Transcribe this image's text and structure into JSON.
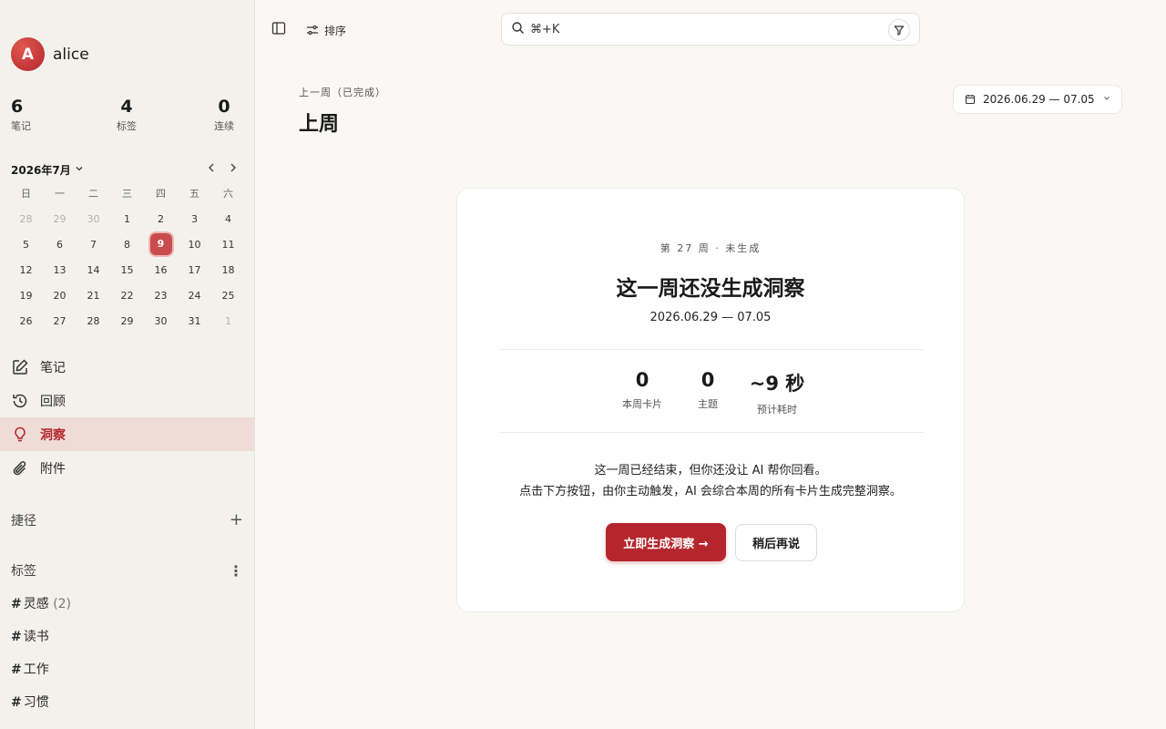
{
  "user": {
    "initial": "A",
    "name": "alice"
  },
  "stats": [
    {
      "value": "6",
      "label": "笔记"
    },
    {
      "value": "4",
      "label": "标签"
    },
    {
      "value": "0",
      "label": "连续"
    }
  ],
  "calendar": {
    "month_label": "2026年7月",
    "weekdays": [
      "日",
      "一",
      "二",
      "三",
      "四",
      "五",
      "六"
    ],
    "weeks": [
      [
        "28",
        "29",
        "30",
        "1",
        "2",
        "3",
        "4"
      ],
      [
        "5",
        "6",
        "7",
        "8",
        "9",
        "10",
        "11"
      ],
      [
        "12",
        "13",
        "14",
        "15",
        "16",
        "17",
        "18"
      ],
      [
        "19",
        "20",
        "21",
        "22",
        "23",
        "24",
        "25"
      ],
      [
        "26",
        "27",
        "28",
        "29",
        "30",
        "31",
        "1"
      ]
    ],
    "today": "9"
  },
  "nav": [
    {
      "label": "笔记",
      "icon": "edit-icon"
    },
    {
      "label": "回顾",
      "icon": "history-icon"
    },
    {
      "label": "洞察",
      "icon": "lightbulb-icon",
      "active": true
    },
    {
      "label": "附件",
      "icon": "paperclip-icon"
    }
  ],
  "shortcuts": {
    "label": "捷径",
    "add": "+"
  },
  "tags_section": {
    "label": "标签",
    "more": "⋮"
  },
  "tags": [
    {
      "name": "灵感",
      "count": "(2)"
    },
    {
      "name": "读书",
      "count": ""
    },
    {
      "name": "工作",
      "count": ""
    },
    {
      "name": "习惯",
      "count": ""
    }
  ],
  "toolbar": {
    "sort_label": "排序"
  },
  "search": {
    "placeholder": "⌘+K"
  },
  "header": {
    "breadcrumb": "上一周（已完成）",
    "title": "上周",
    "date_range": "2026.06.29 — 07.05"
  },
  "card": {
    "meta": "第 27 周 · 未生成",
    "heading": "这一周还没生成洞察",
    "range": "2026.06.29 — 07.05",
    "metrics": [
      {
        "value": "0",
        "label": "本周卡片"
      },
      {
        "value": "0",
        "label": "主题"
      },
      {
        "value": "~9 秒",
        "label": "预计耗时"
      }
    ],
    "desc_line1": "这一周已经结束，但你还没让 AI 帮你回看。",
    "desc_line2": "点击下方按钮，由你主动触发，AI 会综合本周的所有卡片生成完整洞察。",
    "primary_label": "立即生成洞察 →",
    "secondary_label": "稍后再说"
  },
  "colors": {
    "accent": "#b4262c",
    "active_bg": "#efdcd7",
    "sidebar_bg": "#f3f1ec",
    "page_bg": "#faf8f4"
  }
}
